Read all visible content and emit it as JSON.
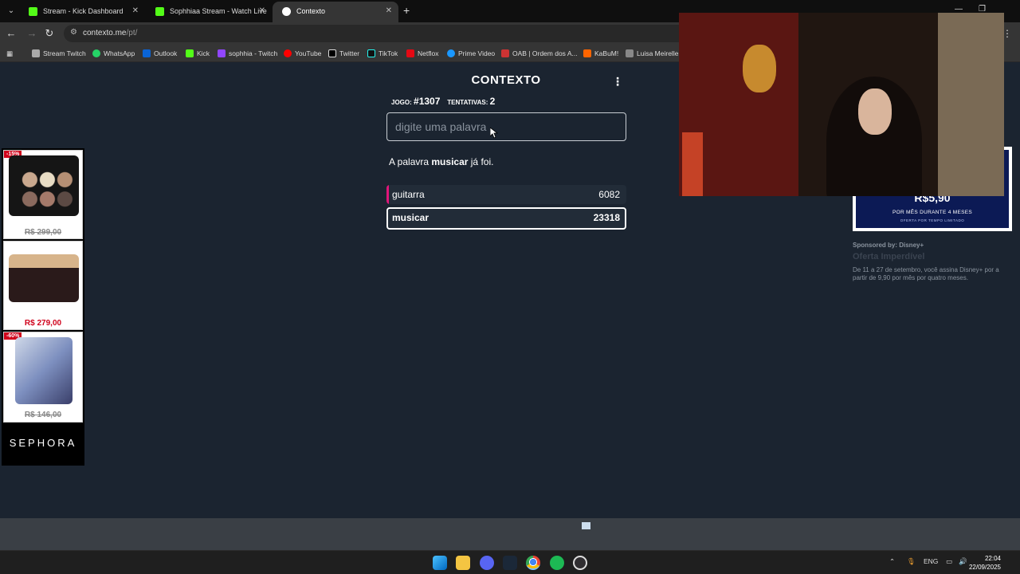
{
  "browser": {
    "tabs": [
      {
        "label": "Stream - Kick Dashboard"
      },
      {
        "label": "Sophhiaa Stream - Watch Live"
      },
      {
        "label": "Contexto"
      }
    ],
    "url_host": "contexto.me",
    "url_path": "/pt/",
    "bookmarks": [
      "Stream Twitch",
      "WhatsApp",
      "Outlook",
      "Kick",
      "sophhia - Twitch",
      "YouTube",
      "Twitter",
      "TikTok",
      "Netflox",
      "Prime Video",
      "OAB | Ordem dos A...",
      "KaBuM!",
      "Luisa Meirelles"
    ]
  },
  "game": {
    "title": "CONTEXTO",
    "game_label": "JOGO:",
    "game_number": "#1307",
    "attempts_label": "TENTATIVAS:",
    "attempts": "2",
    "input_placeholder": "digite uma palavra",
    "message_prefix": "A palavra",
    "message_word": "musicar",
    "message_suffix": "já foi.",
    "guesses": [
      {
        "word": "guitarra",
        "rank": "6082",
        "color": "#e0157a"
      },
      {
        "word": "musicar",
        "rank": "23318",
        "color": "#e0157a"
      }
    ]
  },
  "ad_left": {
    "items": [
      {
        "badge": "-15%",
        "price": "R$ 299,00"
      },
      {
        "badge": "",
        "price": "R$ 279,00"
      },
      {
        "badge": "-60%",
        "price": "R$ 146,00"
      }
    ],
    "brand": "SEPHORA"
  },
  "ad_right": {
    "price": "R$5,90",
    "line1": "POR MÊS DURANTE 4 MESES",
    "line2": "OFERTA POR TEMPO LIMITADO",
    "sponsored": "Sponsored by: Disney+",
    "title": "Oferta Imperdível",
    "body": "De 11 a 27 de setembro, você assina Disney+ por a partir de 9,90 por mês por quatro meses."
  },
  "taskbar": {
    "lang": "ENG",
    "time": "22:04",
    "date": "22/09/2025"
  }
}
